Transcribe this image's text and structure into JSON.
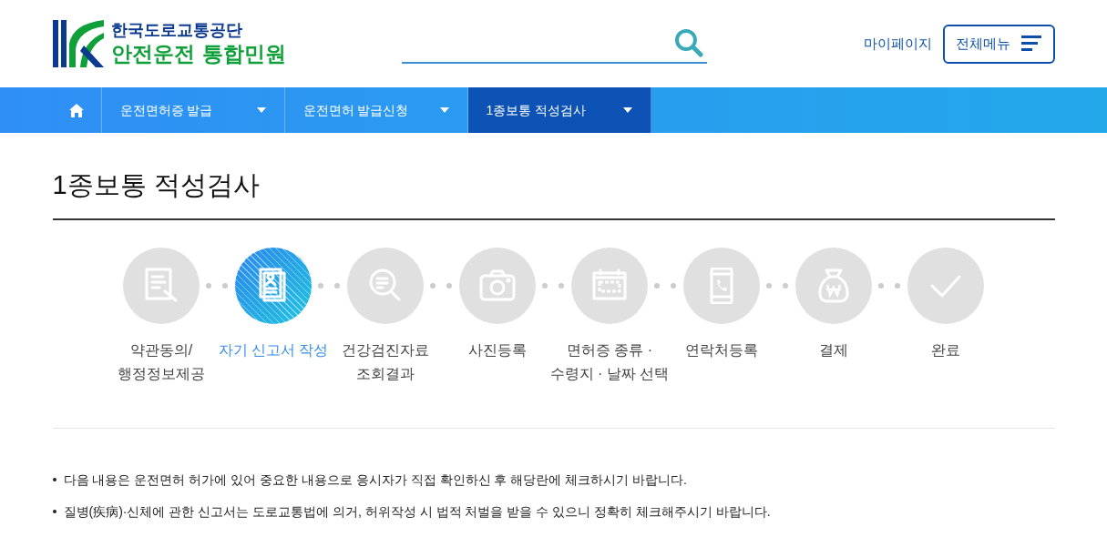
{
  "logo": {
    "org": "한국도로교통공단",
    "service": "안전운전 통합민원"
  },
  "header_links": {
    "mypage": "마이페이지",
    "all_menu": "전체메뉴"
  },
  "nav": {
    "items": [
      {
        "label": "운전면허증 발급",
        "selected": false
      },
      {
        "label": "운전면허 발급신청",
        "selected": false
      },
      {
        "label": "1종보통 적성검사",
        "selected": true
      }
    ]
  },
  "page_title": "1종보통 적성검사",
  "steps": [
    {
      "lines": [
        "약관동의/",
        "행정정보제공"
      ],
      "selected": false
    },
    {
      "lines": [
        "자기 신고서 작성"
      ],
      "selected": true
    },
    {
      "lines": [
        "건강검진자료",
        "조회결과"
      ],
      "selected": false
    },
    {
      "lines": [
        "사진등록"
      ],
      "selected": false
    },
    {
      "lines": [
        "면허증 종류 ·",
        "수령지 · 날짜 선택"
      ],
      "selected": false
    },
    {
      "lines": [
        "연락처등록"
      ],
      "selected": false
    },
    {
      "lines": [
        "결제"
      ],
      "selected": false
    },
    {
      "lines": [
        "완료"
      ],
      "selected": false
    }
  ],
  "notes": [
    "다음 내용은 운전면허 허가에 있어 중요한 내용으로 응시자가 직접 확인하신 후 해당란에 체크하시기 바랍니다.",
    "질병(疾病)·신체에 관한 신고서는 도로교통법에 의거, 허위작성 시 법적 처벌을 받을 수 있으니 정확히 체크해주시기 바랍니다."
  ]
}
